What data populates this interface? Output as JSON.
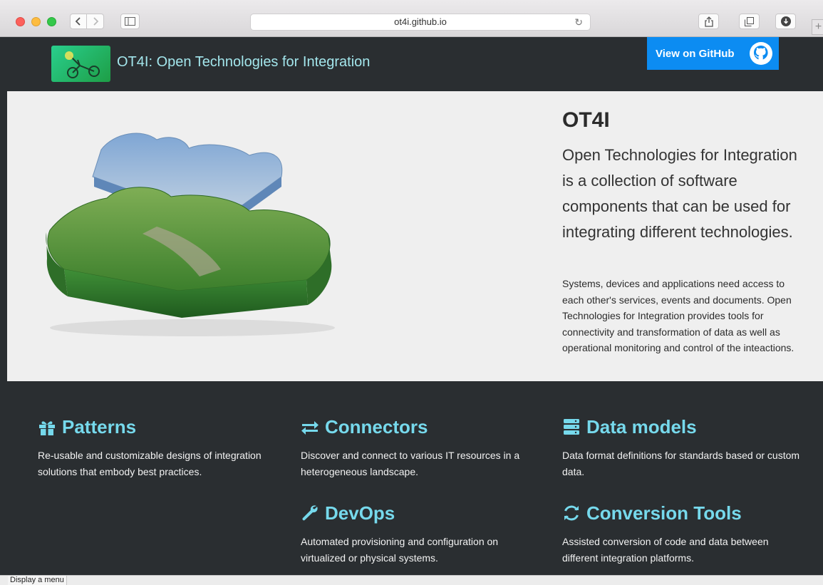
{
  "browser": {
    "url": "ot4i.github.io",
    "back_icon": "chevron-left-icon",
    "forward_icon": "chevron-right-icon",
    "sidebar_icon": "sidebar-icon",
    "reload_icon": "reload-icon",
    "share_icon": "share-icon",
    "tabs_icon": "tabs-icon",
    "download_icon": "download-icon",
    "newtab_label": "+",
    "status_text": "Display a menu"
  },
  "header": {
    "title": "OT4I: Open Technologies for Integration",
    "github_button": "View on GitHub",
    "logo_icon": "bike-logo-icon",
    "github_icon": "github-icon"
  },
  "hero": {
    "title": "OT4I",
    "lead": "Open Technologies for Integration is a collection of software components that can be used for integrating different technologies.",
    "body": "Systems, devices and applications need access to each other's services, events and documents. Open Technologies for Integration provides tools for connectivity and transformation of data as well as operational monitoring and control of the inteactions.",
    "image": "puzzle-pieces-landscape"
  },
  "features": [
    {
      "title": "Patterns",
      "icon": "gift-icon",
      "desc": "Re-usable and customizable designs of integration solutions that embody best practices."
    },
    {
      "title": "Connectors",
      "icon": "exchange-icon",
      "desc": "Discover and connect to various IT resources in a heterogeneous landscape."
    },
    {
      "title": "Data models",
      "icon": "server-icon",
      "desc": "Data format definitions for standards based or custom data."
    },
    {
      "title": "DevOps",
      "icon": "wrench-icon",
      "desc": "Automated provisioning and configuration on virtualized or physical systems."
    },
    {
      "title": "Conversion Tools",
      "icon": "refresh-icon",
      "desc": "Assisted conversion of code and data between different integration platforms."
    }
  ],
  "colors": {
    "accent": "#76d9ec",
    "dark_bg": "#2a2e31",
    "github_blue": "#0c8cf2",
    "hero_bg": "#efefef"
  }
}
